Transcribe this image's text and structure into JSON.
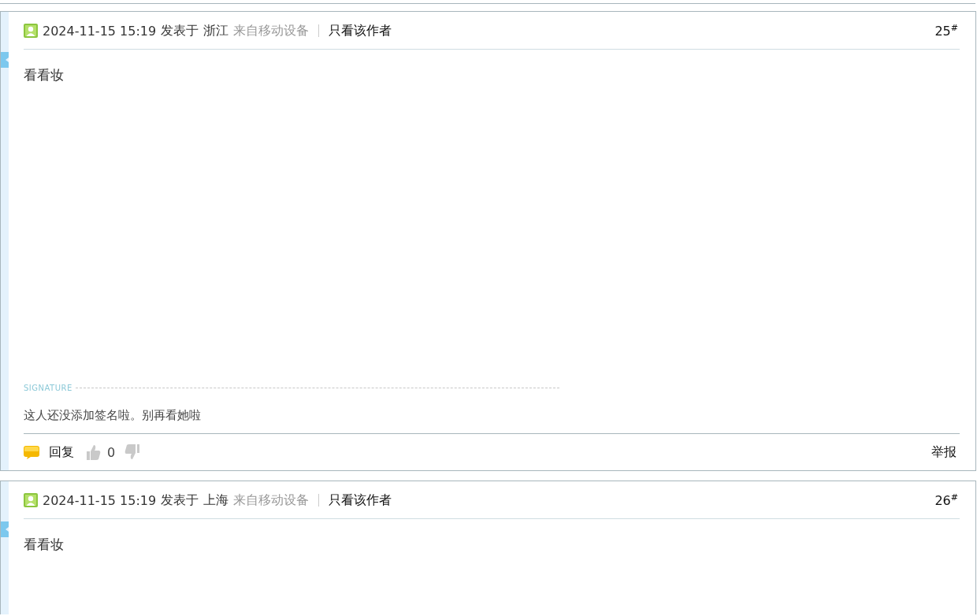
{
  "posts": [
    {
      "time": "2024-11-15 15:19",
      "posted_in": "发表于",
      "location": "浙江",
      "device": "来自移动设备",
      "only_author": "只看该作者",
      "floor": "25$^{#}$",
      "content": "看看妆",
      "signature": {
        "label": "SIGNATURE",
        "text": "这人还没添加签名啦。别再看她啦"
      },
      "footer": {
        "reply": "回复",
        "likes": "0",
        "report": "举报"
      }
    },
    {
      "time": "2024-11-15 15:19",
      "posted_in": "发表于",
      "location": "上海",
      "device": "来自移动设备",
      "only_author": "只看该作者",
      "floor": "26$^{#}$",
      "content": "看看妆"
    }
  ]
}
